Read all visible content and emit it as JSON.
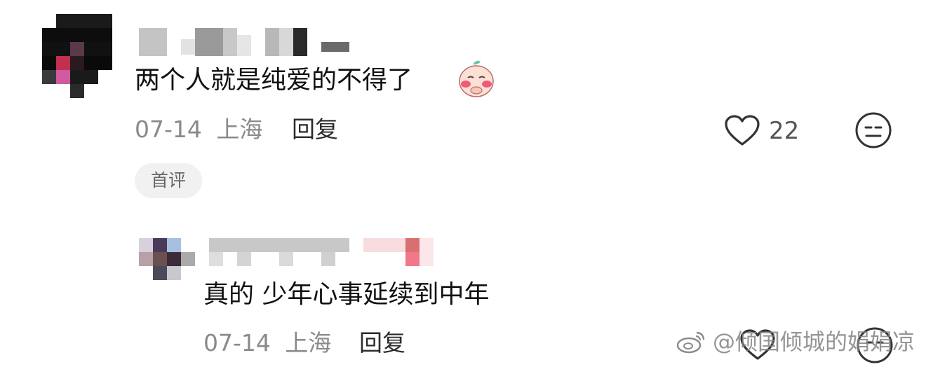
{
  "comments": [
    {
      "text": "两个人就是纯爱的不得了",
      "emoji_icon": "blushing-peach-emoji",
      "date": "07-14",
      "location": "上海",
      "reply_label": "回复",
      "like_count": "22",
      "badge": "首评"
    },
    {
      "text": "真的 少年心事延续到中年",
      "date": "07-14",
      "location": "上海",
      "reply_label": "回复"
    }
  ],
  "icons": {
    "like": "heart-outline-icon",
    "dislike": "neutral-face-icon"
  },
  "watermark": "@倾国倾城的娟娟凉"
}
